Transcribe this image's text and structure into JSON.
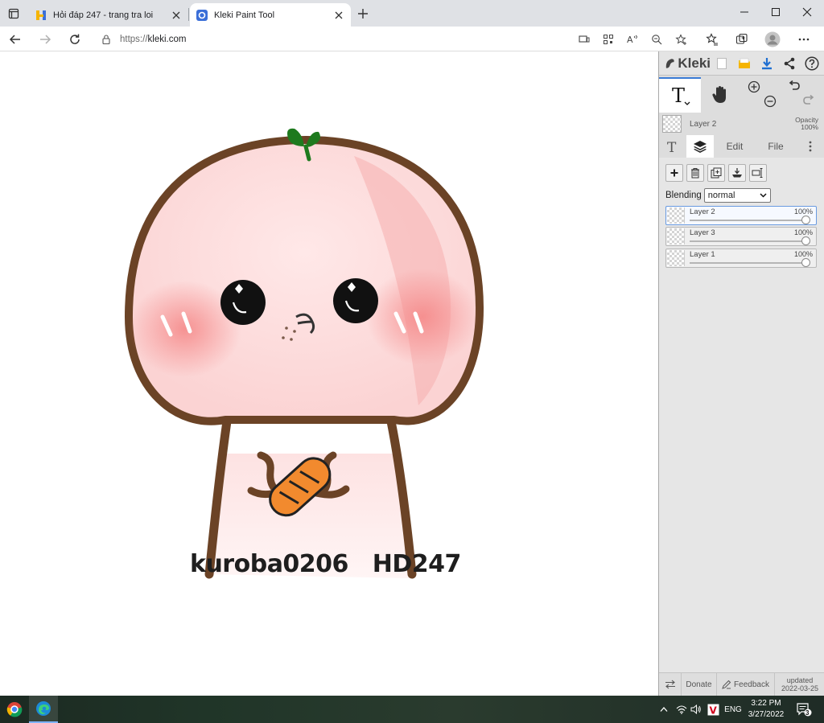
{
  "browser": {
    "tabs": [
      {
        "title": "Hỏi đáp 247 - trang tra loi",
        "active": false
      },
      {
        "title": "Kleki Paint Tool",
        "active": true
      }
    ],
    "url_protocol": "https://",
    "url_host": "kleki.com"
  },
  "canvas": {
    "caption": "kuroba0206   HD247"
  },
  "kleki": {
    "logo": "Kleki",
    "current_layer": "Layer 2",
    "opacity_label": "Opacity",
    "opacity_value": "100%",
    "tabs": {
      "edit": "Edit",
      "file": "File"
    },
    "blending_label": "Blending",
    "blending_value": "normal",
    "layers": [
      {
        "name": "Layer 2",
        "opacity": "100%",
        "selected": true,
        "opacity_fraction": 1.0
      },
      {
        "name": "Layer 3",
        "opacity": "100%",
        "selected": false,
        "opacity_fraction": 1.0
      },
      {
        "name": "Layer 1",
        "opacity": "100%",
        "selected": false,
        "opacity_fraction": 1.0
      }
    ],
    "footer": {
      "donate": "Donate",
      "feedback": "Feedback",
      "updated_label": "updated",
      "updated_date": "2022-03-25"
    }
  },
  "taskbar": {
    "language": "ENG",
    "time": "3:22 PM",
    "date": "3/27/2022",
    "notifications": "3"
  },
  "colors": {
    "accent": "#3a7bd5",
    "outline_brown": "#6b4326",
    "face_pink": "#fde0e0",
    "blush": "#f7a2a2",
    "sprout_green": "#1e7a1e",
    "bread_orange": "#f28a2e"
  }
}
